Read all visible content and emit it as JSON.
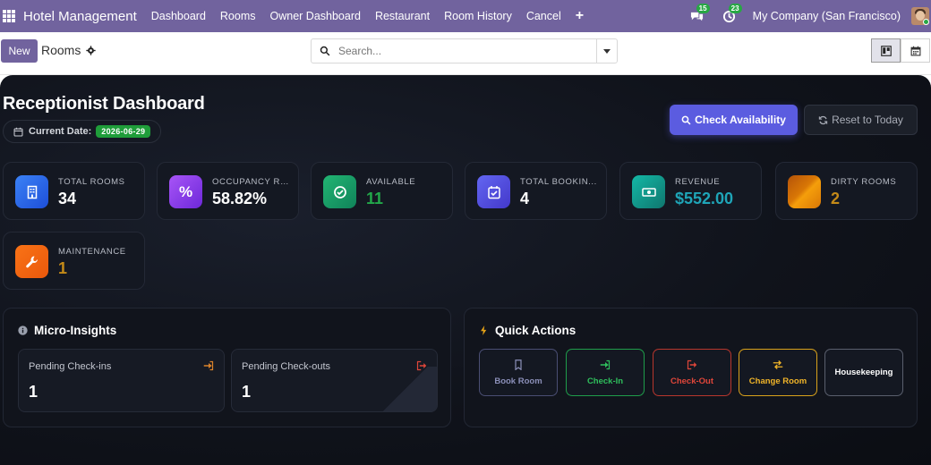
{
  "nav": {
    "brand": "Hotel Management",
    "links": [
      "Dashboard",
      "Rooms",
      "Owner Dashboard",
      "Restaurant",
      "Room History",
      "Cancel"
    ],
    "plus": "+",
    "messages_count": "15",
    "activities_count": "23",
    "company": "My Company (San Francisco)"
  },
  "control": {
    "new_label": "New",
    "title": "Rooms",
    "search_placeholder": "Search..."
  },
  "dashboard": {
    "title": "Receptionist Dashboard",
    "date_label": "Current Date:",
    "date_value": "2026-06-29",
    "check_availability": "Check Availability",
    "reset_today": "Reset to Today",
    "stats": [
      {
        "label": "TOTAL ROOMS",
        "value": "34",
        "color": "#ffffff",
        "icon": "building-icon",
        "icon_bg": "#2563eb"
      },
      {
        "label": "OCCUPANCY RA...",
        "value": "58.82%",
        "color": "#ffffff",
        "icon": "percent-icon",
        "icon_bg": "#8b3fe0"
      },
      {
        "label": "AVAILABLE",
        "value": "11",
        "color": "#22a84a",
        "icon": "check-circle-icon",
        "icon_bg": "#1f9d5f"
      },
      {
        "label": "TOTAL BOOKIN...",
        "value": "4",
        "color": "#ffffff",
        "icon": "calendar-check-icon",
        "icon_bg": "#5b4fe0"
      },
      {
        "label": "REVENUE",
        "value": "$552.00",
        "color": "#1fa5b8",
        "icon": "money-icon",
        "icon_bg": "#139b8c"
      },
      {
        "label": "DIRTY ROOMS",
        "value": "2",
        "color": "#c48a18",
        "icon": "dirty-icon",
        "icon_bg": "#d68a12"
      },
      {
        "label": "MAINTENANCE",
        "value": "1",
        "color": "#c48a18",
        "icon": "wrench-icon",
        "icon_bg": "#ea580c"
      }
    ],
    "insights": {
      "title": "Micro-Insights",
      "pending_checkins_label": "Pending Check-ins",
      "pending_checkins_value": "1",
      "pending_checkouts_label": "Pending Check-outs",
      "pending_checkouts_value": "1"
    },
    "quick_actions": {
      "title": "Quick Actions",
      "book_room": "Book Room",
      "check_in": "Check-In",
      "check_out": "Check-Out",
      "change_room": "Change Room",
      "housekeeping": "Housekeeping"
    }
  }
}
